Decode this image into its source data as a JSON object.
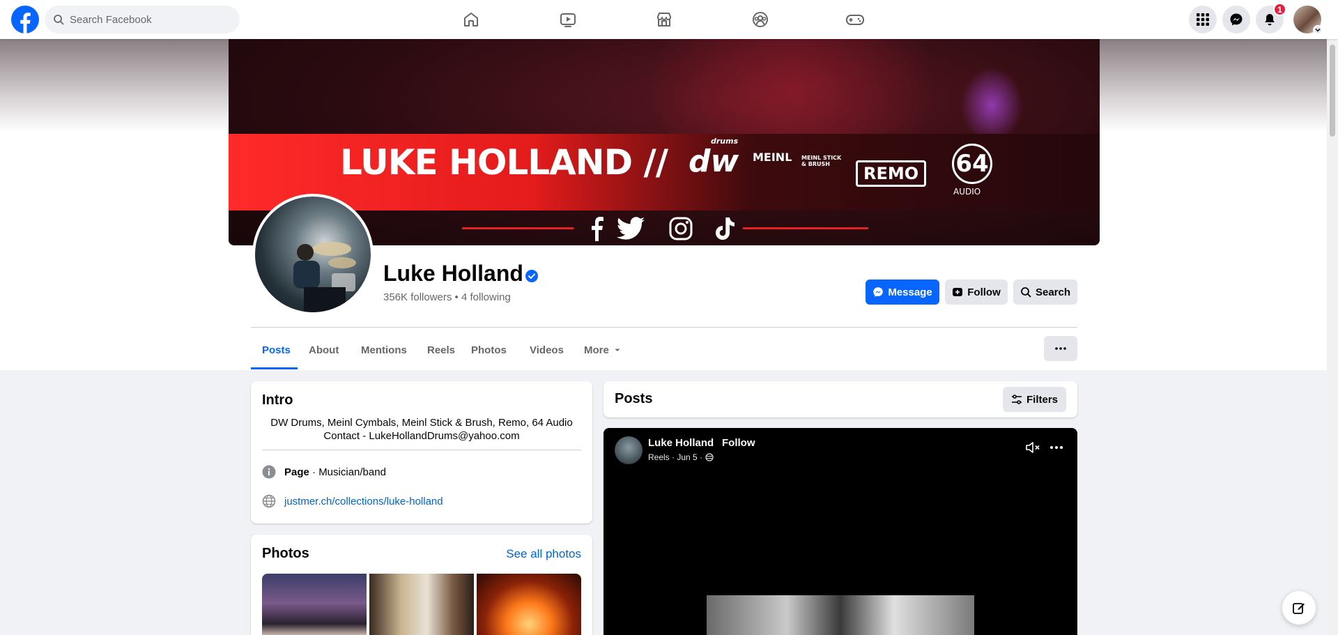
{
  "topbar": {
    "search_placeholder": "Search Facebook",
    "notification_count": "1"
  },
  "cover": {
    "title": "LUKE HOLLAND //",
    "logos": [
      "dw",
      "drums",
      "MEINL",
      "MEINL STICK & BRUSH",
      "REMO",
      "64",
      "AUDIO"
    ]
  },
  "profile": {
    "name": "Luke Holland",
    "stats": "356K followers • 4 following",
    "message_label": "Message",
    "follow_label": "Follow",
    "search_label": "Search"
  },
  "tabs": [
    "Posts",
    "About",
    "Mentions",
    "Reels",
    "Photos",
    "Videos",
    "More"
  ],
  "intro": {
    "title": "Intro",
    "bio_line1": "DW Drums, Meinl Cymbals, Meinl Stick & Brush, Remo, 64 Audio",
    "bio_line2": "Contact - LukeHollandDrums@yahoo.com",
    "page_bold": "Page",
    "page_category": " · Musician/band",
    "website": "justmer.ch/collections/luke-holland"
  },
  "photos": {
    "title": "Photos",
    "see_all": "See all photos"
  },
  "posts": {
    "title": "Posts",
    "filters_label": "Filters"
  },
  "post": {
    "author": "Luke Holland",
    "follow": "Follow",
    "meta": "Reels · Jun 5 ·"
  },
  "colors": {
    "brand": "#0866ff",
    "badge": "#e41e3f",
    "link": "#0064d1"
  }
}
